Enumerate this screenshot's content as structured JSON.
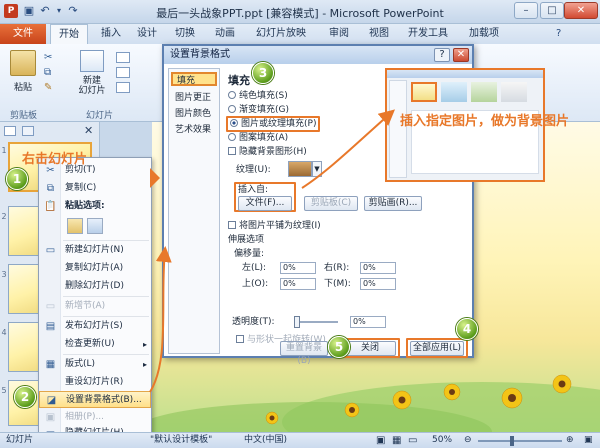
{
  "window": {
    "title": "最后一头战象PPT.ppt [兼容模式] - Microsoft PowerPoint"
  },
  "ribbon": {
    "tabs": [
      "文件",
      "开始",
      "插入",
      "设计",
      "切换",
      "动画",
      "幻灯片放映",
      "审阅",
      "视图",
      "开发工具",
      "加载项"
    ],
    "paste_label": "粘贴",
    "new_slide_label": "新建\n幻灯片",
    "clipboard_group": "剪贴板",
    "slides_group": "幻灯片"
  },
  "slide_panel": {
    "numbers": [
      "1",
      "2",
      "3",
      "4",
      "5",
      "6"
    ]
  },
  "context_menu": {
    "items": [
      {
        "label": "剪切(T)",
        "icon": "scissors-icon",
        "disabled": false
      },
      {
        "label": "复制(C)",
        "icon": "copy-icon",
        "disabled": false
      },
      {
        "label": "粘贴选项:",
        "icon": "paste-icon",
        "disabled": false
      },
      {
        "label": "新建幻灯片(N)",
        "icon": "new-slide-icon",
        "disabled": false
      },
      {
        "label": "复制幻灯片(A)",
        "icon": "duplicate-slide-icon",
        "disabled": false
      },
      {
        "label": "删除幻灯片(D)",
        "icon": "delete-slide-icon",
        "disabled": false
      },
      {
        "label": "新增节(A)",
        "icon": "section-icon",
        "disabled": true
      },
      {
        "label": "发布幻灯片(S)",
        "icon": "publish-icon",
        "disabled": false
      },
      {
        "label": "检查更新(U)",
        "icon": "update-icon",
        "disabled": false
      },
      {
        "label": "版式(L)",
        "icon": "layout-icon",
        "disabled": false
      },
      {
        "label": "重设幻灯片(R)",
        "icon": "reset-icon",
        "disabled": false
      },
      {
        "label": "设置背景格式(B)...",
        "icon": "background-format-icon",
        "disabled": false
      },
      {
        "label": "相册(P)...",
        "icon": "album-icon",
        "disabled": true
      },
      {
        "label": "隐藏幻灯片(H)",
        "icon": "hide-slide-icon",
        "disabled": false
      }
    ]
  },
  "dialog": {
    "title": "设置背景格式",
    "nav": [
      "填充",
      "图片更正",
      "图片颜色",
      "艺术效果"
    ],
    "section_title": "填充",
    "fill_options": [
      "纯色填充(S)",
      "渐变填充(G)",
      "图片或纹理填充(P)",
      "图案填充(A)"
    ],
    "hide_bg_label": "隐藏背景图形(H)",
    "texture_label": "纹理(U):",
    "insert_from_label": "插入自:",
    "file_button": "文件(F)...",
    "clipboard_button": "剪贴板(C)",
    "clipart_button": "剪贴画(R)...",
    "tile_label": "将图片平铺为纹理(I)",
    "stretch_label": "伸展选项",
    "offset_label": "偏移量:",
    "left_label": "左(L):",
    "right_label": "右(R):",
    "top_label": "上(O):",
    "bottom_label": "下(M):",
    "offset_value": "0%",
    "transparency_label": "透明度(T):",
    "transparency_value": "0%",
    "rotate_label": "与形状一起旋转(W)",
    "reset_button": "重置背景(B)",
    "close_button": "关闭",
    "apply_all_button": "全部应用(L)"
  },
  "annotations": {
    "right_click": "右击幻灯片",
    "insert_image": "插入指定图片，做为背景图片",
    "steps": [
      "1",
      "2",
      "3",
      "4",
      "5"
    ]
  },
  "status": {
    "slide_label": "幻灯片",
    "theme": "\"默认设计模板\"",
    "language": "中文(中国)",
    "zoom": "50%"
  },
  "colors": {
    "accent": "#e8782a",
    "callout_text": "#e8782a",
    "file_tab": "#c8441b"
  }
}
